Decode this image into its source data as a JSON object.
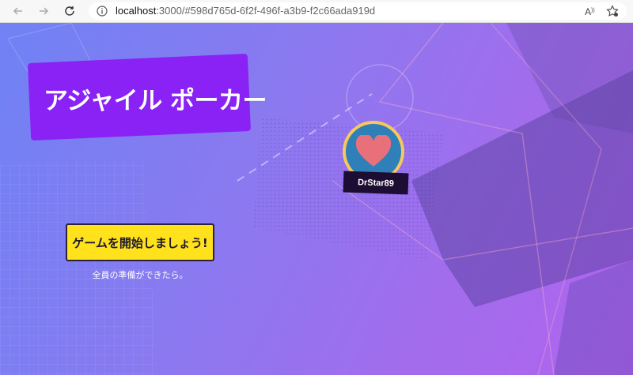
{
  "browser": {
    "url_host": "localhost",
    "url_rest": ":3000/#598d765d-6f2f-496f-a3b9-f2c66ada919d"
  },
  "game": {
    "title": "アジャイル ポーカー",
    "player": {
      "name": "DrStar89",
      "avatar_icon": "heart-icon"
    },
    "start_button_label": "ゲームを開始しましょう!",
    "ready_hint": "全員の準備ができたら。"
  },
  "colors": {
    "title_bg": "#8a22f5",
    "button_bg": "#ffe11c",
    "avatar_ring": "#f6c85f",
    "avatar_bg": "#2f7fb8",
    "heart": "#e8707a"
  }
}
